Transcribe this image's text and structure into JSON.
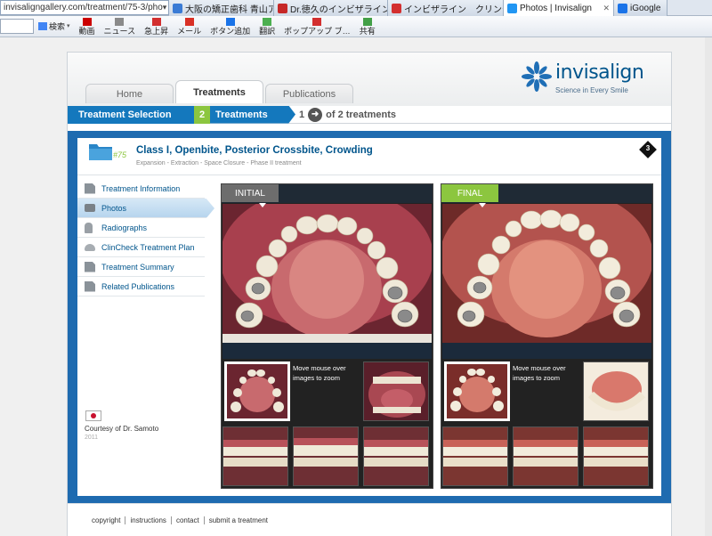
{
  "browser": {
    "url": "invisaligngallery.com/treatment/75-3/pho",
    "url_controls": "▾ ⌕ ▾ ⊠ ↻ ✕",
    "tabs": [
      {
        "label": "大阪の矯正歯科 青山アー…",
        "color": "#3a7bd5",
        "active": false
      },
      {
        "label": "Dr.徳久のインビザライン…",
        "color": "#c62828",
        "active": false
      },
      {
        "label": "インビザライン　クリンチ…",
        "color": "#d32f2f",
        "active": false
      },
      {
        "label": "Photos | Invisalign",
        "color": "#2196f3",
        "active": true
      },
      {
        "label": "iGoogle",
        "color": "#1a73e8",
        "active": false
      }
    ],
    "tab_close": "✕",
    "toolbar": [
      {
        "label": "動画",
        "color": "#cc0000"
      },
      {
        "label": "ニュース",
        "color": "#8a8a8a"
      },
      {
        "label": "急上昇",
        "color": "#d32f2f"
      },
      {
        "label": "メール",
        "color": "#d93025"
      },
      {
        "label": "ボタン追加",
        "color": "#1a73e8"
      },
      {
        "label": "翻訳",
        "color": "#4caf50"
      },
      {
        "label": "ポップアップ ブ…",
        "color": "#d32f2f"
      },
      {
        "label": "共有",
        "color": "#43a047"
      }
    ],
    "search_label": "検索"
  },
  "site": {
    "logo_text": "invisalign",
    "logo_tagline": "Science in Every Smile",
    "tabs": [
      {
        "label": "Home",
        "active": false
      },
      {
        "label": "Treatments",
        "active": true
      },
      {
        "label": "Publications",
        "active": false
      }
    ],
    "breadcrumb": {
      "first": "Treatment Selection",
      "step_num": "2",
      "second": "Treatments",
      "count_current": "1",
      "count_arrow": "➜",
      "count_rest": "of 2 treatments"
    }
  },
  "case": {
    "number": "#75",
    "title": "Class I, Openbite, Posterior Crossbite, Crowding",
    "tags": "Expansion  -  Extraction  -  Space Closure  -  Phase II treatment",
    "difficulty": "3"
  },
  "sidenav": [
    {
      "label": "Treatment Information",
      "icon": "document-icon",
      "active": false
    },
    {
      "label": "Photos",
      "icon": "camera-icon",
      "active": true
    },
    {
      "label": "Radiographs",
      "icon": "tooth-icon",
      "active": false
    },
    {
      "label": "ClinCheck Treatment Plan",
      "icon": "aligner-icon",
      "active": false
    },
    {
      "label": "Treatment Summary",
      "icon": "document-icon",
      "active": false
    },
    {
      "label": "Related Publications",
      "icon": "document-icon",
      "active": false
    }
  ],
  "courtesy": {
    "text": "Courtesy of Dr. Samoto",
    "year": "2011",
    "flag": "japan-flag"
  },
  "panels": {
    "initial_label": "INITIAL",
    "final_label": "FINAL",
    "zoom_hint": "Move mouse over images to zoom"
  },
  "footer": {
    "links": [
      "copyright",
      "instructions",
      "contact",
      "submit a treatment"
    ]
  },
  "colors": {
    "brand_blue": "#1478bd",
    "brand_green": "#8cc63f",
    "frame_blue": "#1e6bb0",
    "title_blue": "#00558c"
  }
}
